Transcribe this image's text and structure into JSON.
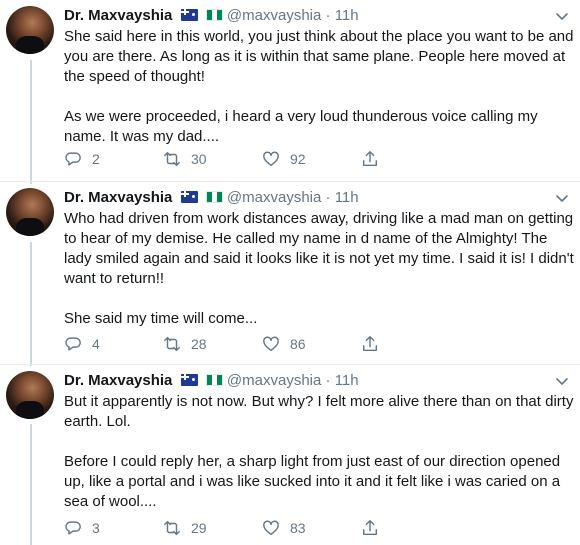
{
  "tweets": [
    {
      "author": {
        "name": "Dr. Maxvayshia",
        "handle": "@maxvayshia"
      },
      "dot": "·",
      "time": "11h",
      "paragraphs": [
        "She said here in this world, you just think about the place you want to be and you are there. As long as it is within that same plane. People here moved at the speed of thought!",
        "As we were proceeded, i heard a very loud thunderous voice calling my name. It was my dad...."
      ],
      "stats": {
        "replies": "2",
        "retweets": "30",
        "likes": "92"
      }
    },
    {
      "author": {
        "name": "Dr. Maxvayshia",
        "handle": "@maxvayshia"
      },
      "dot": "·",
      "time": "11h",
      "paragraphs": [
        "Who had driven from work distances away, driving like a mad man on getting to hear of my demise. He called my name in d name of the Almighty! The lady smiled again and said it looks like it is not yet my time. I said it is! I didn't want to return!!",
        "She said my time will come..."
      ],
      "stats": {
        "replies": "4",
        "retweets": "28",
        "likes": "86"
      }
    },
    {
      "author": {
        "name": "Dr. Maxvayshia",
        "handle": "@maxvayshia"
      },
      "dot": "·",
      "time": "11h",
      "paragraphs": [
        "But it apparently is not now. But why? I felt more alive there than on that dirty earth. Lol.",
        "Before I could reply her, a sharp light from just east of our direction opened up, like a portal and i was like sucked into it and it felt like i was caried on a sea of wool...."
      ],
      "stats": {
        "replies": "3",
        "retweets": "29",
        "likes": "83"
      }
    }
  ],
  "icons": {
    "reply": "speech-bubble-icon",
    "retweet": "retweet-arrows-icon",
    "like": "heart-icon",
    "share": "share-upload-icon",
    "caret": "chevron-down-icon"
  },
  "colors": {
    "text": "#14171a",
    "secondary": "#657786",
    "divider": "#e6ecf0",
    "thread": "#ccd6dd"
  }
}
